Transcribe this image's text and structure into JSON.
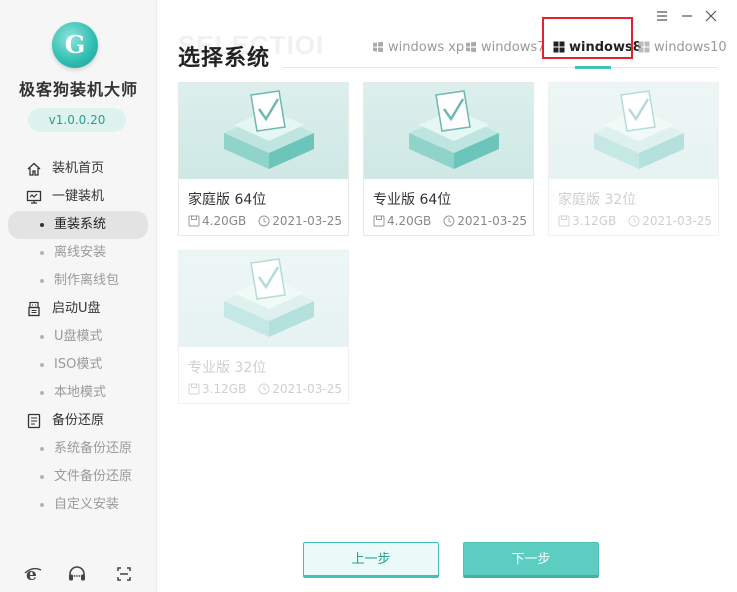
{
  "app": {
    "logo_letter": "G",
    "title": "极客狗装机大师",
    "version": "v1.0.0.20"
  },
  "sidebar": {
    "items": [
      {
        "label": "装机首页",
        "icon": "home-icon",
        "kind": "section"
      },
      {
        "label": "一键装机",
        "icon": "monitor-icon",
        "kind": "section"
      },
      {
        "label": "重装系统",
        "kind": "sub",
        "active": true
      },
      {
        "label": "离线安装",
        "kind": "sub"
      },
      {
        "label": "制作离线包",
        "kind": "sub"
      },
      {
        "label": "启动U盘",
        "icon": "usb-icon",
        "kind": "section"
      },
      {
        "label": "U盘模式",
        "kind": "sub"
      },
      {
        "label": "ISO模式",
        "kind": "sub"
      },
      {
        "label": "本地模式",
        "kind": "sub"
      },
      {
        "label": "备份还原",
        "icon": "backup-icon",
        "kind": "section"
      },
      {
        "label": "系统备份还原",
        "kind": "sub"
      },
      {
        "label": "文件备份还原",
        "kind": "sub"
      },
      {
        "label": "自定义安装",
        "kind": "sub"
      }
    ],
    "bottom_icons": [
      "ie-browser-icon",
      "headset-support-icon",
      "screenshot-icon"
    ]
  },
  "header": {
    "bg_word": "SELECTIOI",
    "title": "选择系统"
  },
  "tabs": [
    {
      "label": "windows xp",
      "active": false
    },
    {
      "label": "windows7",
      "active": false
    },
    {
      "label": "windows8",
      "active": true
    },
    {
      "label": "windows10",
      "active": false
    }
  ],
  "cards": [
    {
      "name": "家庭版 64位",
      "size": "4.20GB",
      "date": "2021-03-25",
      "enabled": true
    },
    {
      "name": "专业版 64位",
      "size": "4.20GB",
      "date": "2021-03-25",
      "enabled": true
    },
    {
      "name": "家庭版 32位",
      "size": "3.12GB",
      "date": "2021-03-25",
      "enabled": false
    },
    {
      "name": "专业版 32位",
      "size": "3.12GB",
      "date": "2021-03-25",
      "enabled": false
    }
  ],
  "buttons": {
    "prev": "上一步",
    "next": "下一步"
  },
  "colors": {
    "accent": "#3ec3b4",
    "highlight": "#e8202a"
  }
}
